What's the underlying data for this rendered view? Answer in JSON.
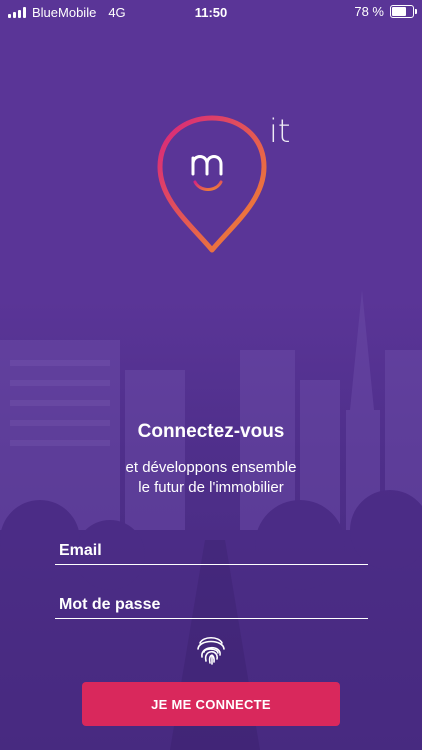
{
  "status_bar": {
    "carrier": "BlueMobile",
    "network": "4G",
    "time": "11:50",
    "battery_text": "78 %",
    "battery_level": 0.78
  },
  "logo": {
    "suffix": "it",
    "icon": "map-pin-smile-logo"
  },
  "login": {
    "title": "Connectez-vous",
    "subtitle_line1": "et développons ensemble",
    "subtitle_line2": "le futur de l'immobilier",
    "email_placeholder": "Email",
    "password_placeholder": "Mot de passe",
    "fingerprint_icon": "fingerprint-icon",
    "submit_label": "JE ME CONNECTE"
  },
  "colors": {
    "background": "#5a3597",
    "cta": "#d9285c",
    "logo_gradient_start": "#d7257e",
    "logo_gradient_end": "#f18a2b"
  }
}
